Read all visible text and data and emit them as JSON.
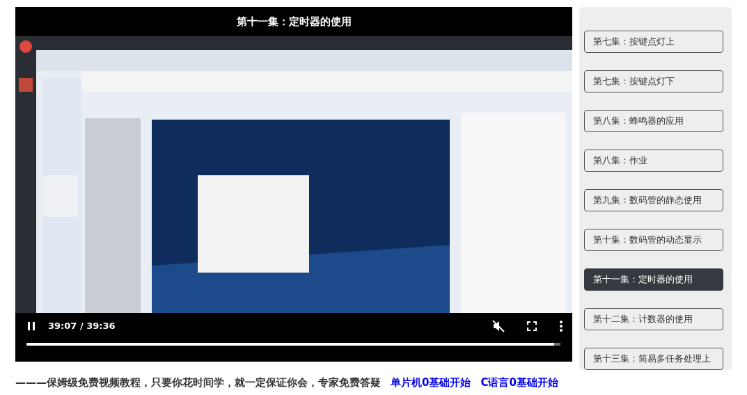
{
  "player": {
    "title": "第十一集：定时器的使用",
    "time": "39:07 / 39:36",
    "playing": true,
    "muted": true,
    "level": 0.988
  },
  "episodes": [
    {
      "label": "第七集：按键点灯上",
      "selected": false
    },
    {
      "label": "第七集：按键点灯下",
      "selected": false
    },
    {
      "label": "第八集：蜂鸣器的应用",
      "selected": false
    },
    {
      "label": "第八集：作业",
      "selected": false
    },
    {
      "label": "第九集：数码管的静态使用",
      "selected": false
    },
    {
      "label": "第十集：数码管的动态显示",
      "selected": false
    },
    {
      "label": "第十一集：定时器的使用",
      "selected": true
    },
    {
      "label": "第十二集：计数器的使用",
      "selected": false
    },
    {
      "label": "第十三集：简易多任务处理上",
      "selected": false
    }
  ],
  "footer": {
    "text": "———保姆级免费视频教程，只要你花时间学，就一定保证你会，专家免费答疑",
    "links": [
      "单片机0基础开始",
      "C语言0基础开始"
    ]
  }
}
